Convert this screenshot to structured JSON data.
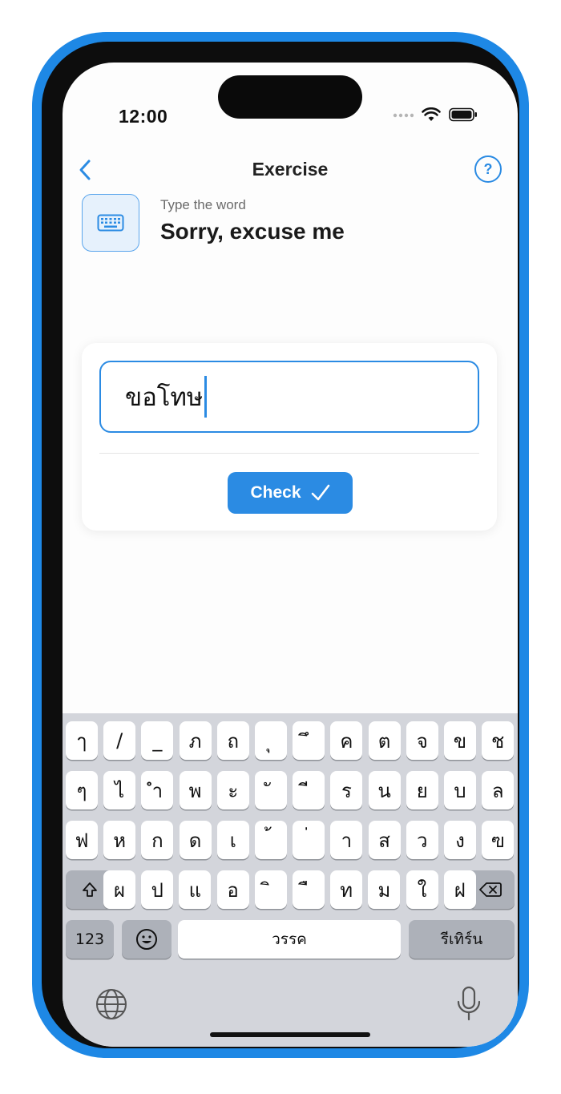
{
  "status": {
    "time": "12:00"
  },
  "nav": {
    "title": "Exercise",
    "help_glyph": "?"
  },
  "prompt": {
    "label": "Type the word",
    "word": "Sorry, excuse me",
    "icon": "keyboard-icon"
  },
  "answer": {
    "value": "ขอโทษ"
  },
  "check": {
    "label": "Check"
  },
  "keyboard": {
    "row1": [
      "ๅ",
      "/",
      "_",
      "ภ",
      "ถ",
      "ุ",
      "ึ",
      "ค",
      "ต",
      "จ",
      "ข",
      "ช"
    ],
    "row2": [
      "ๆ",
      "ไ",
      "ำ",
      "พ",
      "ะ",
      "ั",
      "ี",
      "ร",
      "น",
      "ย",
      "บ",
      "ล"
    ],
    "row3": [
      "ฟ",
      "ห",
      "ก",
      "ด",
      "เ",
      "้",
      "่",
      "า",
      "ส",
      "ว",
      "ง",
      "ฃ"
    ],
    "row4": [
      "ผ",
      "ป",
      "แ",
      "อ",
      "ิ",
      "ื",
      "ท",
      "ม",
      "ใ",
      "ฝ"
    ],
    "numbers_label": "123",
    "space_label": "วรรค",
    "return_label": "รีเทิร์น"
  },
  "colors": {
    "accent": "#2b8be3",
    "frame": "#1e88e5",
    "keyboard_bg": "#d3d5db"
  }
}
